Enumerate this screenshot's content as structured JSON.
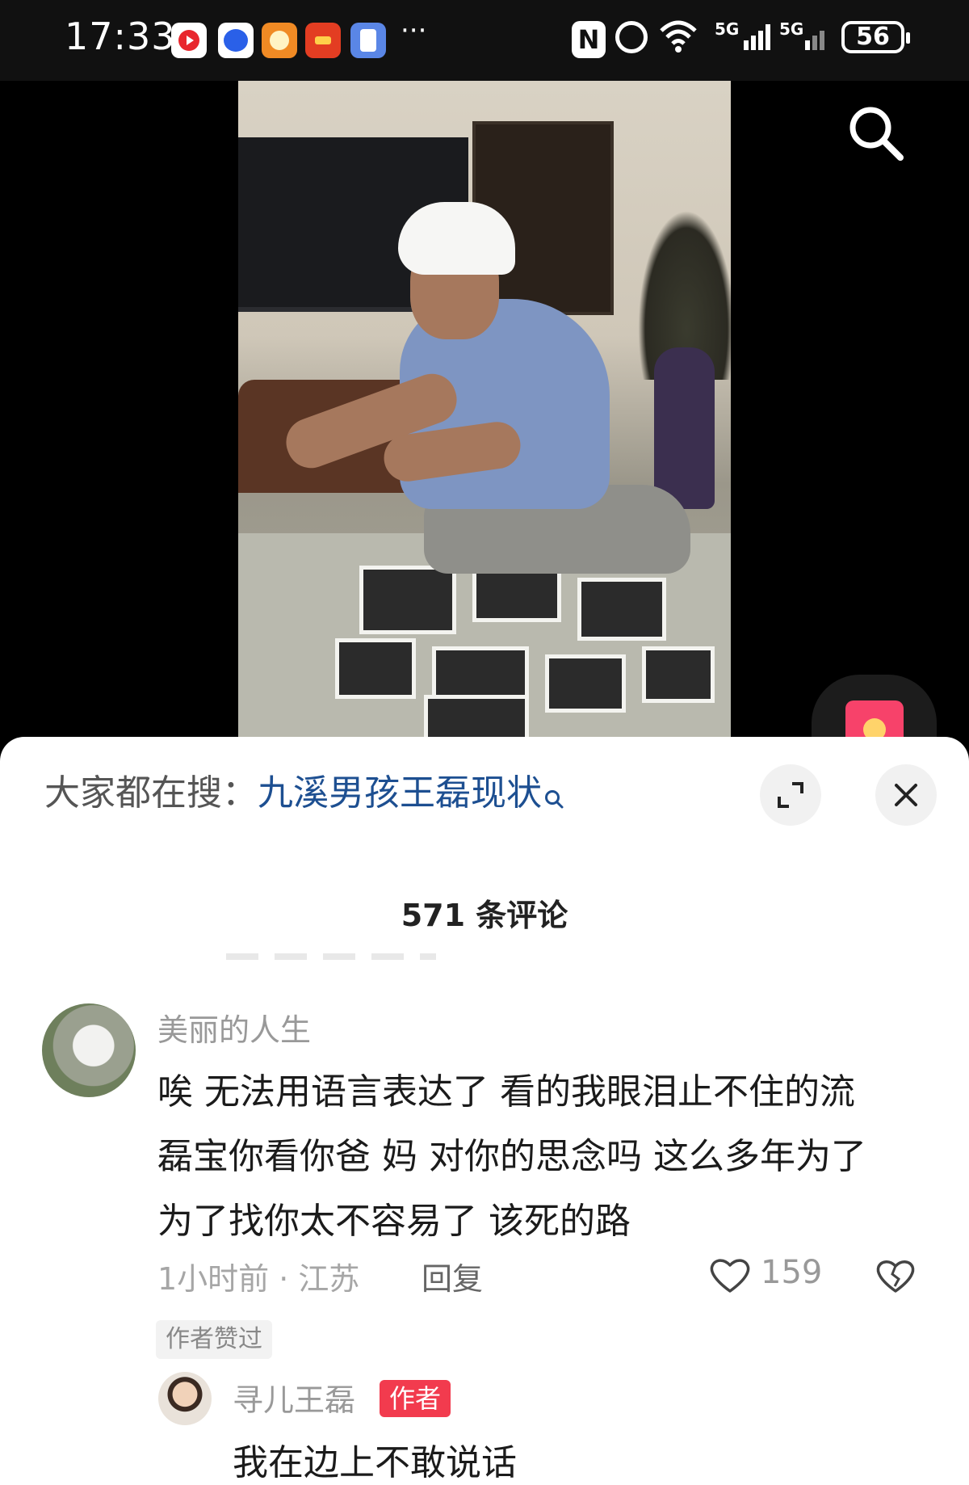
{
  "status_bar": {
    "time": "17:33",
    "more_indicator": "···",
    "nfc": "N",
    "wifi": "⁶",
    "signal_1": "5G",
    "signal_2": "5G",
    "battery": "56"
  },
  "icons": {
    "notifications": [
      "video-app-icon",
      "baidu-icon",
      "red-envelope-app-icon",
      "red-packet-icon",
      "security-app-icon"
    ],
    "search": "search-icon",
    "red_packet": "red-packet-icon",
    "expand": "expand-icon",
    "close": "close-icon",
    "like": "heart-icon",
    "dislike": "broken-heart-icon"
  },
  "sheet": {
    "hot_search_label": "大家都在搜：",
    "hot_search_term": "九溪男孩王磊现状",
    "comment_count": "571 条评论"
  },
  "comment": {
    "username": "美丽的人生",
    "text": "唉 无法用语言表达了  看的我眼泪止不住的流\n磊宝你看你爸 妈 对你的思念吗 这么多年为了\n为了找你太不容易了  该死的路",
    "time_location": "1小时前 · 江苏",
    "reply_label": "回复",
    "like_count": "159",
    "author_liked_tag": "作者赞过"
  },
  "reply": {
    "username": "寻儿王磊",
    "badge": "作者",
    "text": "我在边上不敢说话"
  },
  "colors": {
    "hot_search_term": "#1d4f91",
    "author_badge": "#f23b4e",
    "status_bar_bg": "#111111"
  }
}
